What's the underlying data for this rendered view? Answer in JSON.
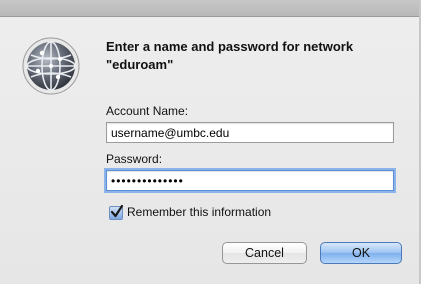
{
  "dialog": {
    "heading": "Enter a name and password for network \"eduroam\"",
    "account_label": "Account Name:",
    "account_value": "username@umbc.edu",
    "password_label": "Password:",
    "password_value": "••••••••••••••",
    "remember_label": "Remember this information",
    "remember_checked": true,
    "cancel_label": "Cancel",
    "ok_label": "OK",
    "icon": "network-globe-icon"
  },
  "colors": {
    "focus_ring": "#8db4ea",
    "default_button": "#9cc2f1",
    "window_bg": "#ececec"
  }
}
